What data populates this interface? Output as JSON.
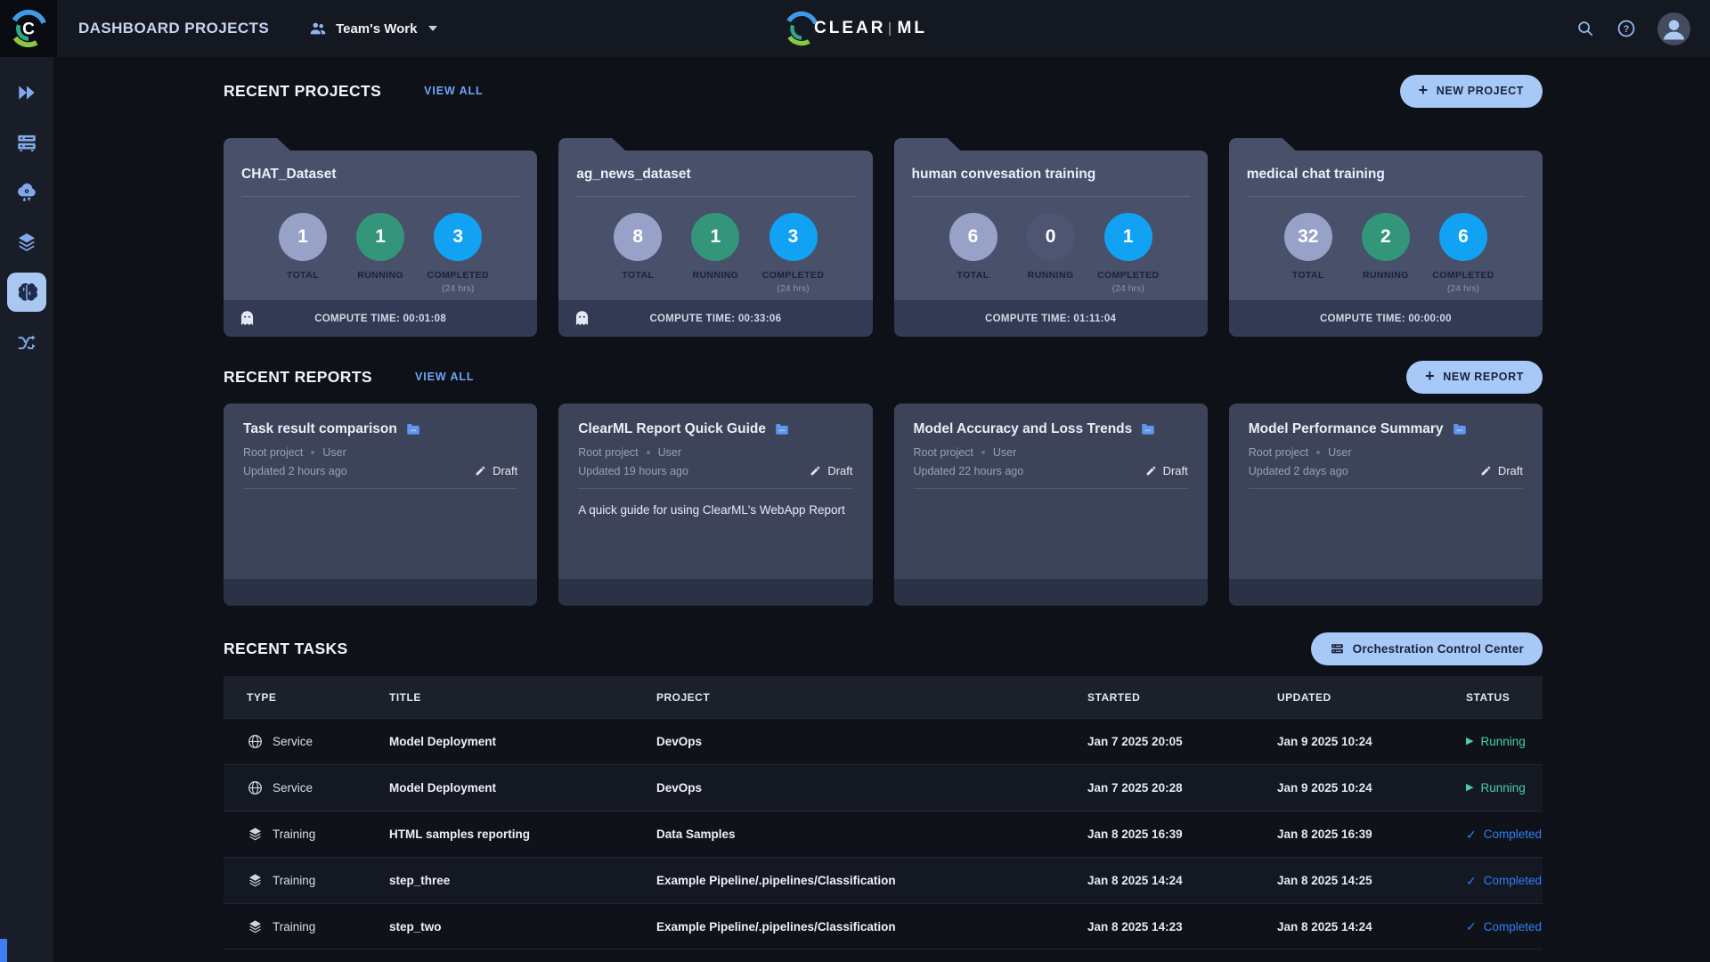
{
  "topbar": {
    "title": "DASHBOARD PROJECTS",
    "workspace_label": "Team's Work",
    "logo_letter": "C",
    "logo_clear": "CLEAR",
    "logo_ml": "ML"
  },
  "sidebar": {
    "icons": [
      "double-play-icon",
      "workers-queues-icon",
      "cloud-apps-icon",
      "datasets-icon",
      "brain-projects-icon",
      "pipelines-icon"
    ],
    "active_icon": "brain-projects-icon"
  },
  "projects": {
    "heading": "RECENT PROJECTS",
    "view_all": "VIEW ALL",
    "new_button": "NEW PROJECT",
    "labels": {
      "total": "TOTAL",
      "running": "RUNNING",
      "completed": "COMPLETED",
      "window": "(24 hrs)"
    },
    "cards": [
      {
        "title": "CHAT_Dataset",
        "total": {
          "value": "1",
          "color": "#98a2c8"
        },
        "running": {
          "value": "1",
          "color": "#33967b"
        },
        "completed": {
          "value": "3",
          "color": "#12a2f4"
        },
        "compute": "COMPUTE TIME: 00:01:08",
        "ghost": true
      },
      {
        "title": "ag_news_dataset",
        "total": {
          "value": "8",
          "color": "#98a2c8"
        },
        "running": {
          "value": "1",
          "color": "#33967b"
        },
        "completed": {
          "value": "3",
          "color": "#12a2f4"
        },
        "compute": "COMPUTE TIME: 00:33:06",
        "ghost": true
      },
      {
        "title": "human convesation training",
        "total": {
          "value": "6",
          "color": "#98a2c8"
        },
        "running": {
          "value": "0",
          "color": "#4d5572"
        },
        "completed": {
          "value": "1",
          "color": "#12a2f4"
        },
        "compute": "COMPUTE TIME: 01:11:04",
        "ghost": false
      },
      {
        "title": "medical chat training",
        "total": {
          "value": "32",
          "color": "#98a2c8"
        },
        "running": {
          "value": "2",
          "color": "#33967b"
        },
        "completed": {
          "value": "6",
          "color": "#12a2f4"
        },
        "compute": "COMPUTE TIME: 00:00:00",
        "ghost": false
      }
    ]
  },
  "reports": {
    "heading": "RECENT REPORTS",
    "view_all": "VIEW ALL",
    "new_button": "NEW REPORT",
    "cards": [
      {
        "title": "Task result comparison",
        "project": "Root project",
        "author": "User",
        "updated": "Updated 2 hours ago",
        "status": "Draft",
        "body": ""
      },
      {
        "title": "ClearML Report Quick Guide",
        "project": "Root project",
        "author": "User",
        "updated": "Updated 19 hours ago",
        "status": "Draft",
        "body": "A quick guide for using ClearML's WebApp Report"
      },
      {
        "title": "Model Accuracy and Loss Trends",
        "project": "Root project",
        "author": "User",
        "updated": "Updated 22 hours ago",
        "status": "Draft",
        "body": ""
      },
      {
        "title": "Model Performance Summary",
        "project": "Root project",
        "author": "User",
        "updated": "Updated 2 days ago",
        "status": "Draft",
        "body": ""
      }
    ]
  },
  "tasks": {
    "heading": "RECENT TASKS",
    "orchestration_button": "Orchestration Control Center",
    "columns": [
      "TYPE",
      "TITLE",
      "PROJECT",
      "STARTED",
      "UPDATED",
      "STATUS"
    ],
    "rows": [
      {
        "icon": "globe",
        "type": "Service",
        "title": "Model Deployment",
        "project": "DevOps",
        "started": "Jan 7 2025 20:05",
        "updated": "Jan 9 2025 10:24",
        "status": "Running",
        "status_color": "#45d2a6"
      },
      {
        "icon": "globe",
        "type": "Service",
        "title": "Model Deployment",
        "project": "DevOps",
        "started": "Jan 7 2025 20:28",
        "updated": "Jan 9 2025 10:24",
        "status": "Running",
        "status_color": "#45d2a6"
      },
      {
        "icon": "layers",
        "type": "Training",
        "title": "HTML samples reporting",
        "project": "Data Samples",
        "started": "Jan 8 2025 16:39",
        "updated": "Jan 8 2025 16:39",
        "status": "Completed",
        "status_color": "#2f7ef7"
      },
      {
        "icon": "layers",
        "type": "Training",
        "title": "step_three",
        "project": "Example Pipeline/.pipelines/Classification",
        "started": "Jan 8 2025 14:24",
        "updated": "Jan 8 2025 14:25",
        "status": "Completed",
        "status_color": "#2f7ef7"
      },
      {
        "icon": "layers",
        "type": "Training",
        "title": "step_two",
        "project": "Example Pipeline/.pipelines/Classification",
        "started": "Jan 8 2025 14:23",
        "updated": "Jan 8 2025 14:24",
        "status": "Completed",
        "status_color": "#2f7ef7"
      }
    ]
  },
  "colors": {
    "accent_link": "#6ea6f8",
    "button_bg": "#a7c9f8",
    "running_green": "#45d2a6",
    "completed_blue": "#2f7ef7"
  }
}
